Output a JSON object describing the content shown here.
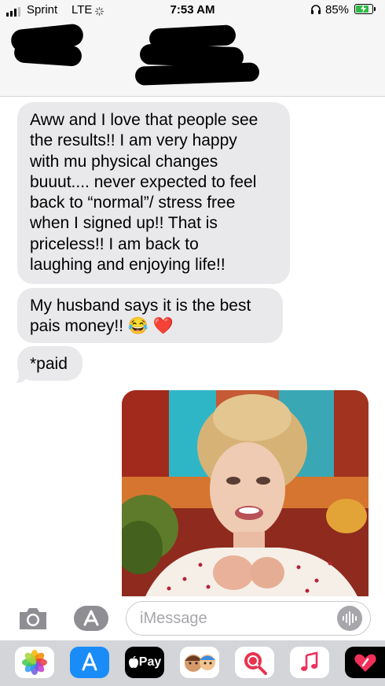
{
  "status_bar": {
    "carrier": "Sprint",
    "network": "LTE",
    "time": "7:53 AM",
    "battery_percent": "85%",
    "battery_level": 0.85,
    "icons": [
      "signal-bars-icon",
      "loading-spinner-icon",
      "headphones-icon",
      "battery-charging-icon"
    ]
  },
  "conversation": {
    "messages": [
      {
        "sender": "contact",
        "text": "Aww and I love that people see\nthe results!! I am very happy\nwith mu physical changes\nbuuut.... never expected to feel\nback to “normal”/ stress free\nwhen I signed up!! That is\npriceless!! I am back to\nlaughing and enjoying life!!"
      },
      {
        "sender": "contact",
        "text": "My husband says it is the best\npais money!! 😂 ❤️"
      },
      {
        "sender": "contact",
        "text": "*paid"
      }
    ],
    "attachment": {
      "type": "gif",
      "icon": "animated-gif-image"
    }
  },
  "input_bar": {
    "placeholder": "iMessage",
    "icons": [
      "camera-icon",
      "app-store-icon",
      "audio-waveform-icon"
    ]
  },
  "app_drawer": {
    "apps": [
      {
        "name": "photos",
        "icon": "photos-icon"
      },
      {
        "name": "app-store",
        "icon": "app-store-icon"
      },
      {
        "name": "apple-pay",
        "label": "Pay",
        "icon": "apple-pay-icon"
      },
      {
        "name": "memoji",
        "icon": "memoji-icon"
      },
      {
        "name": "search-images",
        "icon": "globe-search-icon"
      },
      {
        "name": "music",
        "icon": "music-note-icon"
      },
      {
        "name": "digital-touch",
        "icon": "heart-touch-icon"
      }
    ]
  },
  "colors": {
    "incoming_bubble": "#e9e9eb",
    "header_background": "#f6f6f6",
    "drawer_background": "#d3d5d9",
    "battery_fill": "#2dbb45",
    "app_store_blue": "#1a8cf7"
  }
}
